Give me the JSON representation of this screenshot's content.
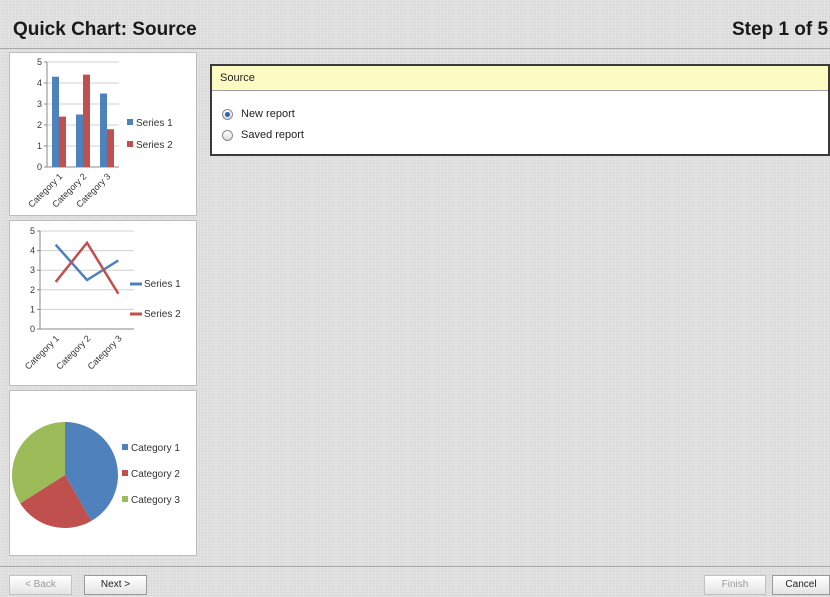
{
  "header": {
    "title": "Quick Chart: Source",
    "step": "Step 1 of 5"
  },
  "thumbnails": [
    {
      "chart_data": {
        "type": "bar",
        "categories": [
          "Category 1",
          "Category 2",
          "Category 3"
        ],
        "series": [
          {
            "name": "Series 1",
            "values": [
              4.3,
              2.5,
              3.5
            ],
            "color": "#4f81bd"
          },
          {
            "name": "Series 2",
            "values": [
              2.4,
              4.4,
              1.8
            ],
            "color": "#c0504d"
          }
        ],
        "ylim": [
          0,
          5
        ],
        "yticks": [
          "0",
          "1",
          "2",
          "3",
          "4",
          "5"
        ],
        "legend": "right"
      }
    },
    {
      "chart_data": {
        "type": "line",
        "categories": [
          "Category 1",
          "Category 2",
          "Category 3"
        ],
        "series": [
          {
            "name": "Series 1",
            "values": [
              4.3,
              2.5,
              3.5
            ],
            "color": "#4f81bd"
          },
          {
            "name": "Series 2",
            "values": [
              2.4,
              4.4,
              1.8
            ],
            "color": "#c0504d"
          }
        ],
        "ylim": [
          0,
          5
        ],
        "yticks": [
          "0",
          "1",
          "2",
          "3",
          "4",
          "5"
        ],
        "legend": "right"
      }
    },
    {
      "chart_data": {
        "type": "pie",
        "categories": [
          "Category 1",
          "Category 2",
          "Category 3"
        ],
        "values": [
          4.3,
          2.5,
          3.5
        ],
        "colors": [
          "#4f81bd",
          "#c0504d",
          "#9bbb59"
        ],
        "legend": "right"
      }
    }
  ],
  "source_panel": {
    "header": "Source",
    "options": [
      {
        "label": "New report",
        "selected": true
      },
      {
        "label": "Saved report",
        "selected": false
      }
    ]
  },
  "footer": {
    "back_label": "< Back",
    "next_label": "Next >",
    "finish_label": "Finish",
    "cancel_label": "Cancel"
  }
}
